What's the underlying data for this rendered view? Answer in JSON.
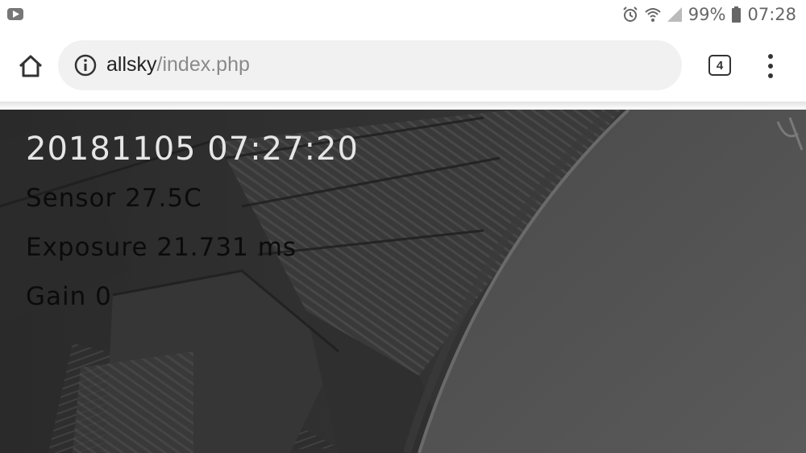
{
  "status_bar": {
    "battery": "99%",
    "time": "07:28",
    "icons": [
      "youtube-icon",
      "alarm-icon",
      "wifi-icon",
      "signal-icon",
      "battery-icon"
    ]
  },
  "browser": {
    "url_host": "allsky",
    "url_path": "/index.php",
    "tab_count": "4",
    "icons": [
      "home-icon",
      "info-icon",
      "more-vert-icon"
    ]
  },
  "camera_overlay": {
    "timestamp": "20181105 07:27:20",
    "sensor": "Sensor 27.5C",
    "exposure": "Exposure 21.731 ms",
    "gain": "Gain 0"
  }
}
